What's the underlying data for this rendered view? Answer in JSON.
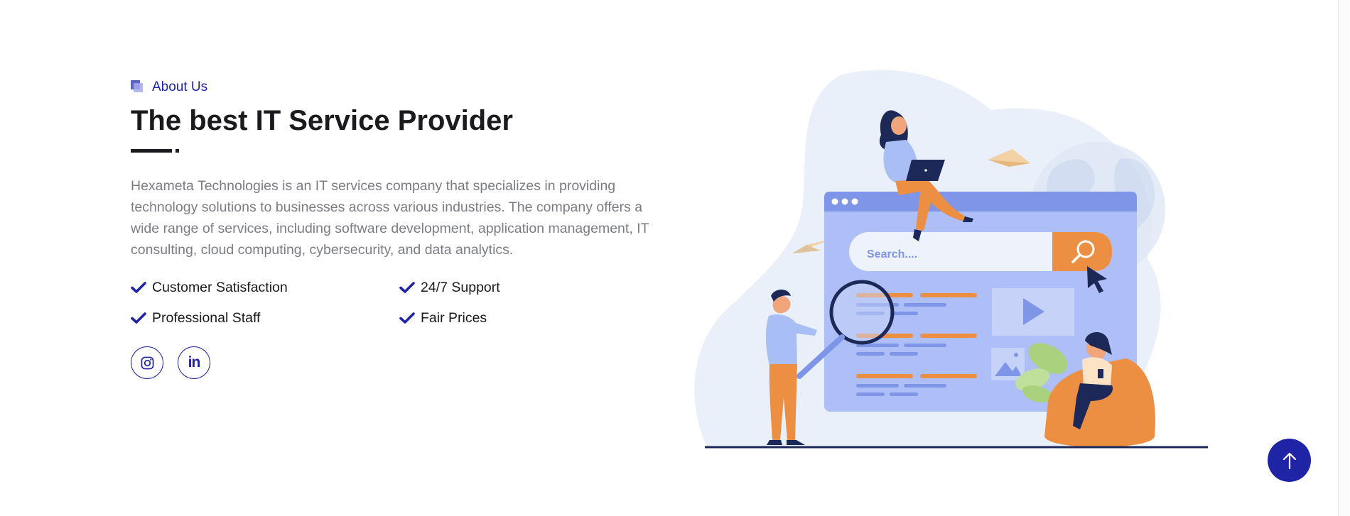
{
  "about": {
    "subtitle": "About Us",
    "title": "The best IT Service Provider",
    "description": "Hexameta Technologies is an IT services company that specializes in providing technology solutions to businesses across various industries. The company offers a wide range of services, including software development, application management, IT consulting, cloud computing, cybersecurity, and data analytics.",
    "features": [
      {
        "label": "Customer Satisfaction",
        "icon": "check-icon"
      },
      {
        "label": "24/7 Support",
        "icon": "check-icon"
      },
      {
        "label": "Professional Staff",
        "icon": "check-icon"
      },
      {
        "label": "Fair Prices",
        "icon": "check-icon"
      }
    ],
    "socials": [
      {
        "name": "instagram",
        "icon": "instagram-icon"
      },
      {
        "name": "linkedin",
        "icon": "linkedin-icon",
        "glyph": "in"
      }
    ]
  },
  "illustration": {
    "search_placeholder": "Search...."
  },
  "back_to_top": {
    "icon": "arrow-up-icon"
  },
  "colors": {
    "accent": "#1f23a6",
    "heading": "#1b1b1f",
    "body_text": "#7b7d85",
    "illustration_primary": "#7f95e8",
    "illustration_orange": "#f0994a",
    "blob": "#eaf0f9"
  }
}
